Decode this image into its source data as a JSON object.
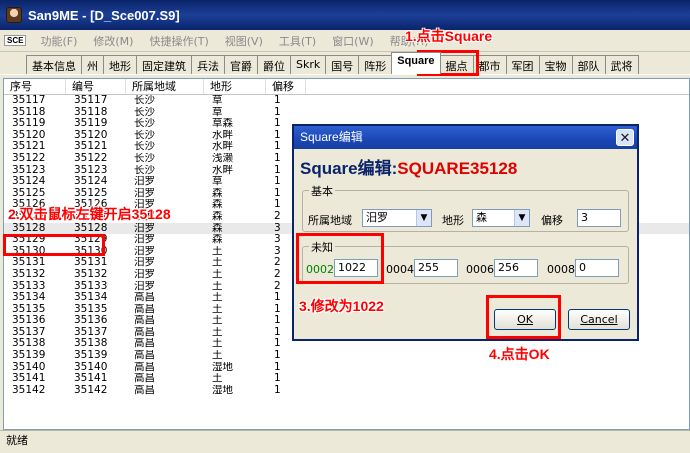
{
  "window": {
    "title": "San9ME - [D_Sce007.S9]"
  },
  "menu": {
    "logo": "SCE",
    "items": [
      "功能(F)",
      "修改(M)",
      "快捷操作(T)",
      "视图(V)",
      "工具(T)",
      "窗口(W)",
      "帮助(H)"
    ]
  },
  "tabs": [
    "基本信息",
    "州",
    "地形",
    "固定建筑",
    "兵法",
    "官爵",
    "爵位",
    "Skrk",
    "国号",
    "阵形",
    "Square",
    "据点",
    "都市",
    "军团",
    "宝物",
    "部队",
    "武将"
  ],
  "active_tab": "Square",
  "list": {
    "headers": [
      "序号",
      "编号",
      "所属地域",
      "地形",
      "偏移"
    ],
    "rows": [
      [
        "35117",
        "35117",
        "长沙",
        "草",
        "1"
      ],
      [
        "35118",
        "35118",
        "长沙",
        "草",
        "1"
      ],
      [
        "35119",
        "35119",
        "长沙",
        "草森",
        "1"
      ],
      [
        "35120",
        "35120",
        "长沙",
        "水畔",
        "1"
      ],
      [
        "35121",
        "35121",
        "长沙",
        "水畔",
        "1"
      ],
      [
        "35122",
        "35122",
        "长沙",
        "浅濑",
        "1"
      ],
      [
        "35123",
        "35123",
        "长沙",
        "水畔",
        "1"
      ],
      [
        "35124",
        "35124",
        "汨罗",
        "草",
        "1"
      ],
      [
        "35125",
        "35125",
        "汨罗",
        "森",
        "1"
      ],
      [
        "35126",
        "35126",
        "汨罗",
        "森",
        "1"
      ],
      [
        "35127",
        "35127",
        "汨罗",
        "森",
        "2"
      ],
      [
        "35128",
        "35128",
        "汨罗",
        "森",
        "3"
      ],
      [
        "35129",
        "35129",
        "汨罗",
        "森",
        "3"
      ],
      [
        "35130",
        "35130",
        "汨罗",
        "土",
        "3"
      ],
      [
        "35131",
        "35131",
        "汨罗",
        "土",
        "2"
      ],
      [
        "35132",
        "35132",
        "汨罗",
        "土",
        "2"
      ],
      [
        "35133",
        "35133",
        "汨罗",
        "土",
        "2"
      ],
      [
        "35134",
        "35134",
        "高昌",
        "土",
        "1"
      ],
      [
        "35135",
        "35135",
        "高昌",
        "土",
        "1"
      ],
      [
        "35136",
        "35136",
        "高昌",
        "土",
        "1"
      ],
      [
        "35137",
        "35137",
        "高昌",
        "土",
        "1"
      ],
      [
        "35138",
        "35138",
        "高昌",
        "土",
        "1"
      ],
      [
        "35139",
        "35139",
        "高昌",
        "土",
        "1"
      ],
      [
        "35140",
        "35140",
        "高昌",
        "湿地",
        "1"
      ],
      [
        "35141",
        "35141",
        "高昌",
        "土",
        "1"
      ],
      [
        "35142",
        "35142",
        "高昌",
        "湿地",
        "1"
      ]
    ]
  },
  "status": {
    "text": "就绪"
  },
  "dialog": {
    "title": "Square编辑",
    "heading_prefix": "Square编辑:",
    "heading_id": "SQUARE35128",
    "basic_group": "基本",
    "region_label": "所属地域",
    "region_value": "汨罗",
    "terrain_label": "地形",
    "terrain_value": "森",
    "offset_label": "偏移",
    "offset_value": "3",
    "unknown_group": "未知",
    "fields": [
      {
        "label": "0002",
        "value": "1022"
      },
      {
        "label": "0004",
        "value": "255"
      },
      {
        "label": "0006",
        "value": "256"
      },
      {
        "label": "0008",
        "value": "0"
      }
    ],
    "ok_label": "OK",
    "cancel_label": "Cancel"
  },
  "annotations": {
    "step1": "1.点击Square",
    "step2": "2.双击鼠标左键开启35128",
    "step3": "3.修改为1022",
    "step4": "4.点击OK"
  },
  "colors": {
    "annotation": "#ff0000",
    "heading": "#0a246a",
    "heading_accent": "#e00000",
    "field_label_green": "#008000"
  }
}
